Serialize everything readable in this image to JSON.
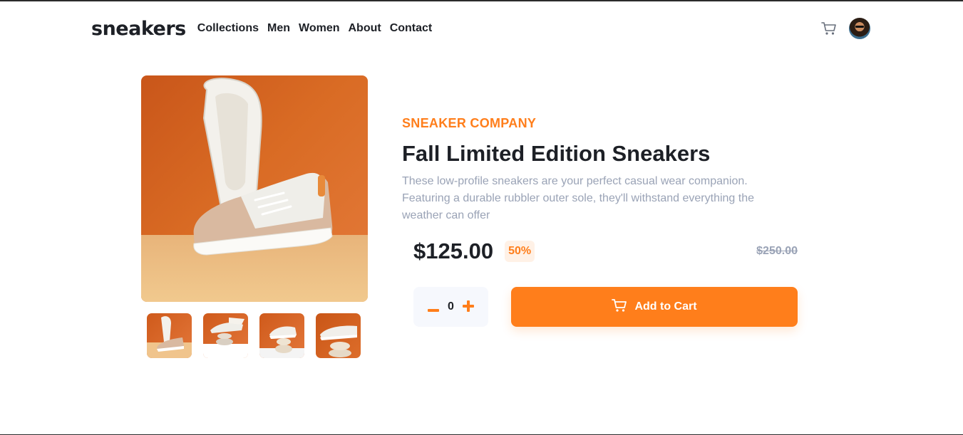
{
  "brand": {
    "logo": "sneakers"
  },
  "nav": {
    "items": [
      "Collections",
      "Men",
      "Women",
      "About",
      "Contact"
    ]
  },
  "header": {
    "cart_icon": "cart-icon",
    "avatar_icon": "user-avatar"
  },
  "product": {
    "company": "SNEAKER COMPANY",
    "title": "Fall Limited Edition Sneakers",
    "description": "These low-profile sneakers are your perfect casual wear companion. Featuring a durable rubbler outer sole, they'll withstand everything the weather can offer",
    "price": "$125.00",
    "discount": "50%",
    "original_price": "$250.00",
    "quantity": "0",
    "minus_symbol": "−",
    "plus_symbol": "+",
    "add_to_cart_label": "Add to Cart"
  },
  "gallery": {
    "thumbnail_count": 4
  },
  "colors": {
    "accent": "#ff7e1b",
    "dark": "#1d2026",
    "muted": "#9aa3b6",
    "badge_bg": "#fff1e6"
  }
}
